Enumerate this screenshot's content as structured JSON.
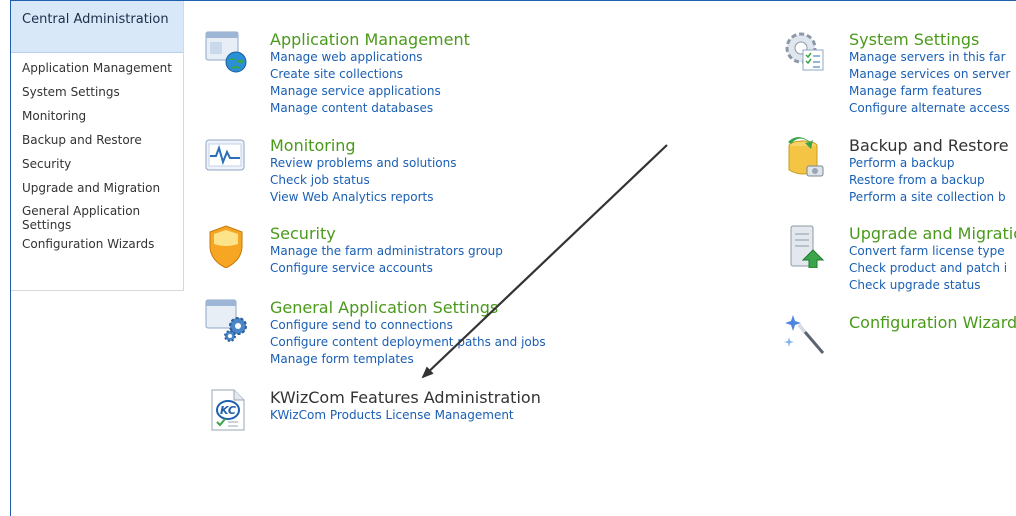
{
  "nav": {
    "header": "Central Administration",
    "items": [
      {
        "label": "Application Management"
      },
      {
        "label": "System Settings"
      },
      {
        "label": "Monitoring"
      },
      {
        "label": "Backup and Restore"
      },
      {
        "label": "Security"
      },
      {
        "label": "Upgrade and Migration"
      },
      {
        "label": "General Application Settings"
      },
      {
        "label": "Configuration Wizards"
      }
    ]
  },
  "sections": {
    "app_mgmt": {
      "title": "Application Management",
      "icon": "web-application-globe-icon",
      "links": [
        "Manage web applications",
        "Create site collections",
        "Manage service applications",
        "Manage content databases"
      ]
    },
    "monitoring": {
      "title": "Monitoring",
      "icon": "monitoring-chart-icon",
      "links": [
        "Review problems and solutions",
        "Check job status",
        "View Web Analytics reports"
      ]
    },
    "security": {
      "title": "Security",
      "icon": "shield-icon",
      "links": [
        "Manage the farm administrators group",
        "Configure service accounts"
      ]
    },
    "general": {
      "title": "General Application Settings",
      "icon": "settings-gears-icon",
      "links": [
        "Configure send to connections",
        "Configure content deployment paths and jobs",
        "Manage form templates"
      ]
    },
    "kwizcom": {
      "title": "KWizCom Features Administration",
      "icon": "kwizcom-logo-icon",
      "links": [
        "KWizCom Products License Management"
      ]
    },
    "system": {
      "title": "System Settings",
      "icon": "system-settings-gear-icon",
      "links": [
        "Manage servers in this far",
        "Manage services on server",
        "Manage farm features",
        "Configure alternate access"
      ]
    },
    "backup": {
      "title": "Backup and Restore",
      "icon": "backup-database-icon",
      "links": [
        "Perform a backup",
        "Restore from a backup",
        "Perform a site collection b"
      ]
    },
    "upgrade": {
      "title": "Upgrade and Migratio",
      "icon": "upgrade-server-icon",
      "links": [
        "Convert farm license type",
        "Check product and patch i",
        "Check upgrade status"
      ]
    },
    "wizards": {
      "title": "Configuration Wizard",
      "icon": "magic-wand-icon",
      "links": []
    }
  },
  "colors": {
    "title_green": "#4a9a1a",
    "link_blue": "#1a5fb4",
    "nav_header_bg": "#d9e8f9",
    "frame_blue": "#1f5fae"
  }
}
